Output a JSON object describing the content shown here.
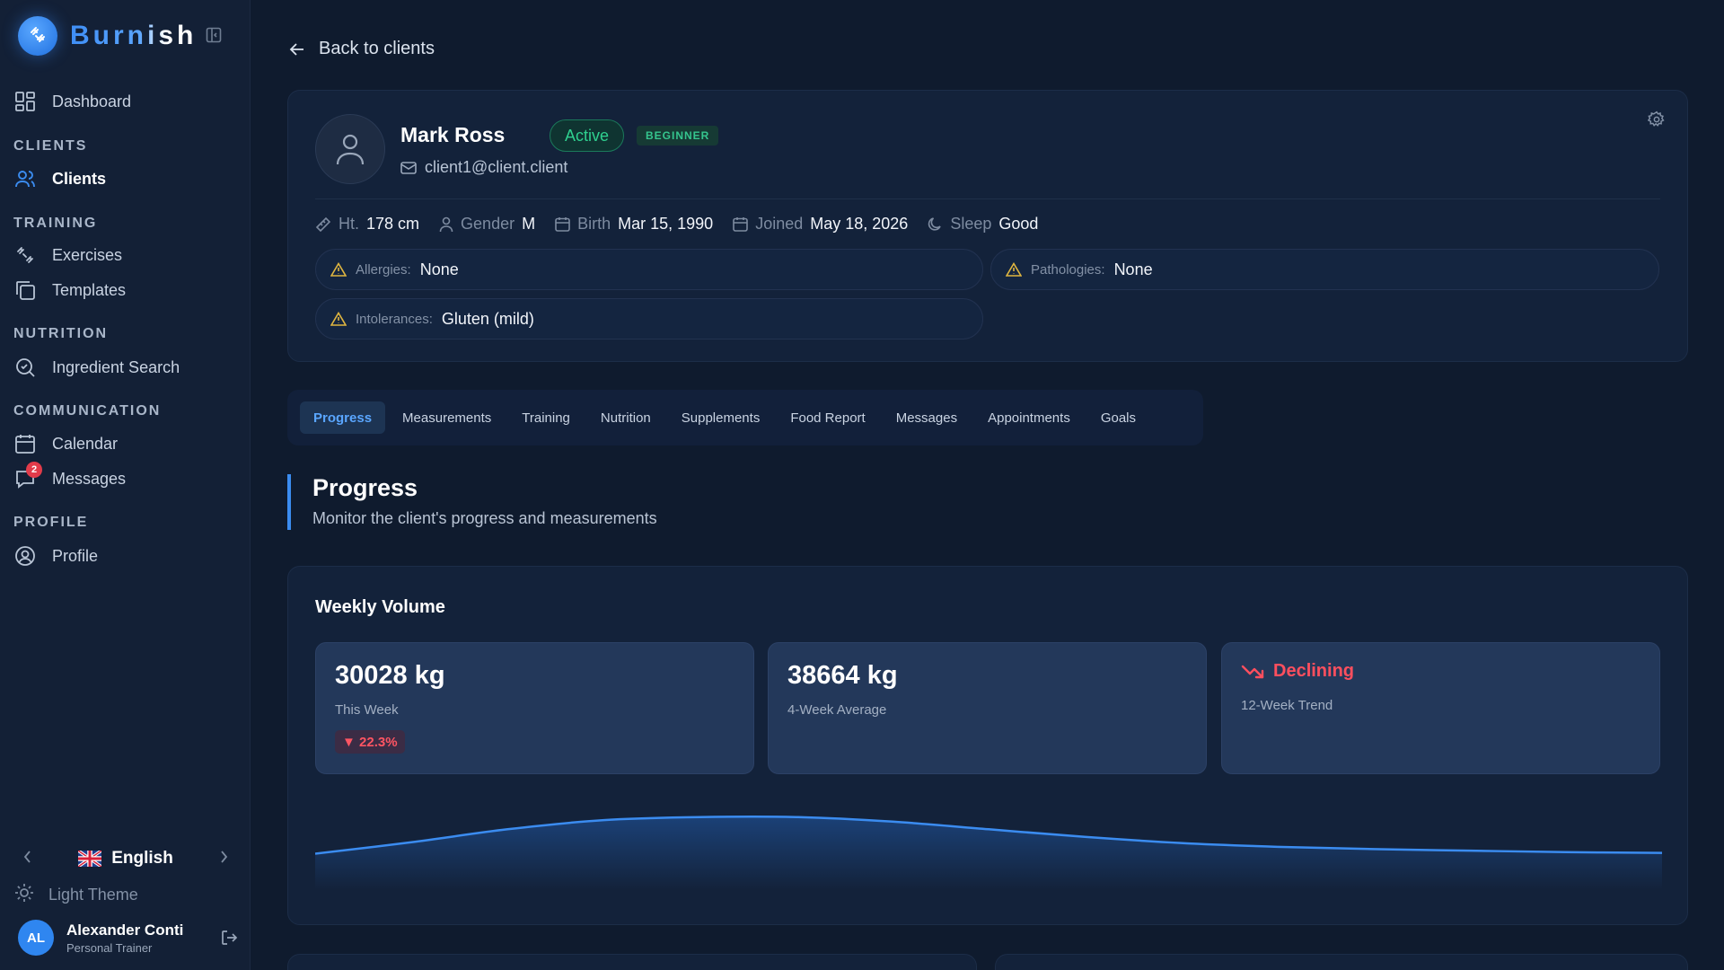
{
  "brand": {
    "name": "Burnish"
  },
  "sidebar": {
    "dashboard": "Dashboard",
    "sections": {
      "clients": "CLIENTS",
      "training": "TRAINING",
      "nutrition": "NUTRITION",
      "communication": "COMMUNICATION",
      "profile": "PROFILE"
    },
    "items": {
      "clients": "Clients",
      "exercises": "Exercises",
      "templates": "Templates",
      "ingredient_search": "Ingredient Search",
      "calendar": "Calendar",
      "messages": "Messages",
      "messages_badge": "2",
      "profile": "Profile"
    },
    "language": "English",
    "theme": "Light Theme",
    "user": {
      "initials": "AL",
      "name": "Alexander Conti",
      "role": "Personal Trainer"
    }
  },
  "main": {
    "back": "Back to clients",
    "client": {
      "name": "Mark Ross",
      "status": "Active",
      "level": "BEGINNER",
      "email": "client1@client.client",
      "facts": [
        {
          "key": "Ht.",
          "value": "178 cm"
        },
        {
          "key": "Gender",
          "value": "M"
        },
        {
          "key": "Birth",
          "value": "Mar 15, 1990"
        },
        {
          "key": "Joined",
          "value": "May 18, 2026"
        },
        {
          "key": "Sleep",
          "value": "Good"
        }
      ],
      "allergies": {
        "label": "Allergies:",
        "value": "None"
      },
      "pathologies": {
        "label": "Pathologies:",
        "value": "None"
      },
      "intolerances": {
        "label": "Intolerances:",
        "value": "Gluten (mild)"
      }
    },
    "tabs": [
      "Progress",
      "Measurements",
      "Training",
      "Nutrition",
      "Supplements",
      "Food Report",
      "Messages",
      "Appointments",
      "Goals"
    ],
    "active_tab": "Progress",
    "section": {
      "title": "Progress",
      "subtitle": "Monitor the client's progress and measurements"
    },
    "weekly_volume": {
      "title": "Weekly Volume",
      "this_week": {
        "value": "30028 kg",
        "label": "This Week",
        "delta": "▼ 22.3%"
      },
      "average": {
        "value": "38664 kg",
        "label": "4-Week Average"
      },
      "trend": {
        "value": "Declining",
        "label": "12-Week Trend"
      }
    }
  },
  "colors": {
    "accent": "#3b8cf0",
    "success": "#2fd08f",
    "danger": "#ff4f5e",
    "warning": "#e0b640"
  },
  "chart_data": {
    "type": "area",
    "title": "",
    "series": [
      {
        "values": [
          0.3,
          0.45,
          0.62,
          0.74,
          0.78,
          0.78,
          0.72,
          0.62,
          0.52,
          0.44,
          0.39,
          0.36,
          0.34,
          0.32,
          0.31
        ]
      }
    ],
    "grid": false,
    "legend": "none"
  }
}
